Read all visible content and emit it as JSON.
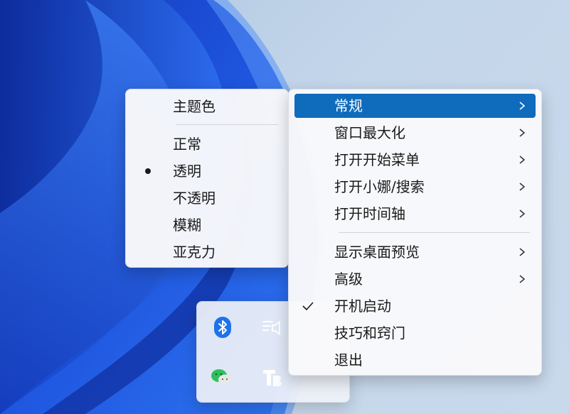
{
  "theme_menu": {
    "header": "主题色",
    "options": [
      {
        "label": "正常",
        "selected": false
      },
      {
        "label": "透明",
        "selected": true
      },
      {
        "label": "不透明",
        "selected": false
      },
      {
        "label": "模糊",
        "selected": false
      },
      {
        "label": "亚克力",
        "selected": false
      }
    ]
  },
  "main_menu": {
    "items": [
      {
        "label": "常规",
        "submenu": true,
        "highlighted": true
      },
      {
        "label": "窗口最大化",
        "submenu": true
      },
      {
        "label": "打开开始菜单",
        "submenu": true
      },
      {
        "label": "打开小娜/搜索",
        "submenu": true
      },
      {
        "label": "打开时间轴",
        "submenu": true
      },
      {
        "label": "显示桌面预览",
        "submenu": true
      },
      {
        "label": "高级",
        "submenu": true
      },
      {
        "label": "开机启动",
        "checked": true
      },
      {
        "label": "技巧和窍门"
      },
      {
        "label": "退出"
      }
    ]
  },
  "tray": {
    "icons": [
      "bluetooth-icon",
      "speaker-icon",
      "wechat-icon",
      "translucenttb-icon"
    ]
  },
  "colors": {
    "accent": "#0f6cbd",
    "wallpaper_blue": "#1f4fd6"
  }
}
